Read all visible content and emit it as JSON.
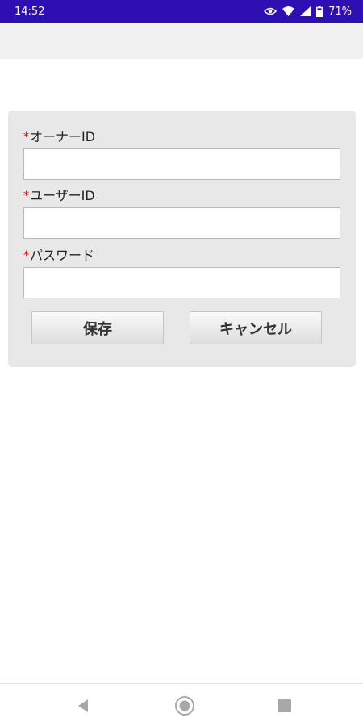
{
  "status_bar": {
    "time": "14:52",
    "battery": "71%",
    "icons": [
      "eye-icon",
      "wifi-icon",
      "signal-icon",
      "battery-icon"
    ]
  },
  "form": {
    "required_mark": "*",
    "owner_id": {
      "label": "オーナーID",
      "value": ""
    },
    "user_id": {
      "label": "ユーザーID",
      "value": ""
    },
    "password": {
      "label": "パスワード",
      "value": ""
    },
    "save_label": "保存",
    "cancel_label": "キャンセル"
  },
  "nav_bar": {
    "icons": [
      "back-icon",
      "home-icon",
      "recents-icon"
    ]
  },
  "colors": {
    "status_bar": "#2e0fb4",
    "required": "#cc0000",
    "panel": "#e8e8e8"
  }
}
